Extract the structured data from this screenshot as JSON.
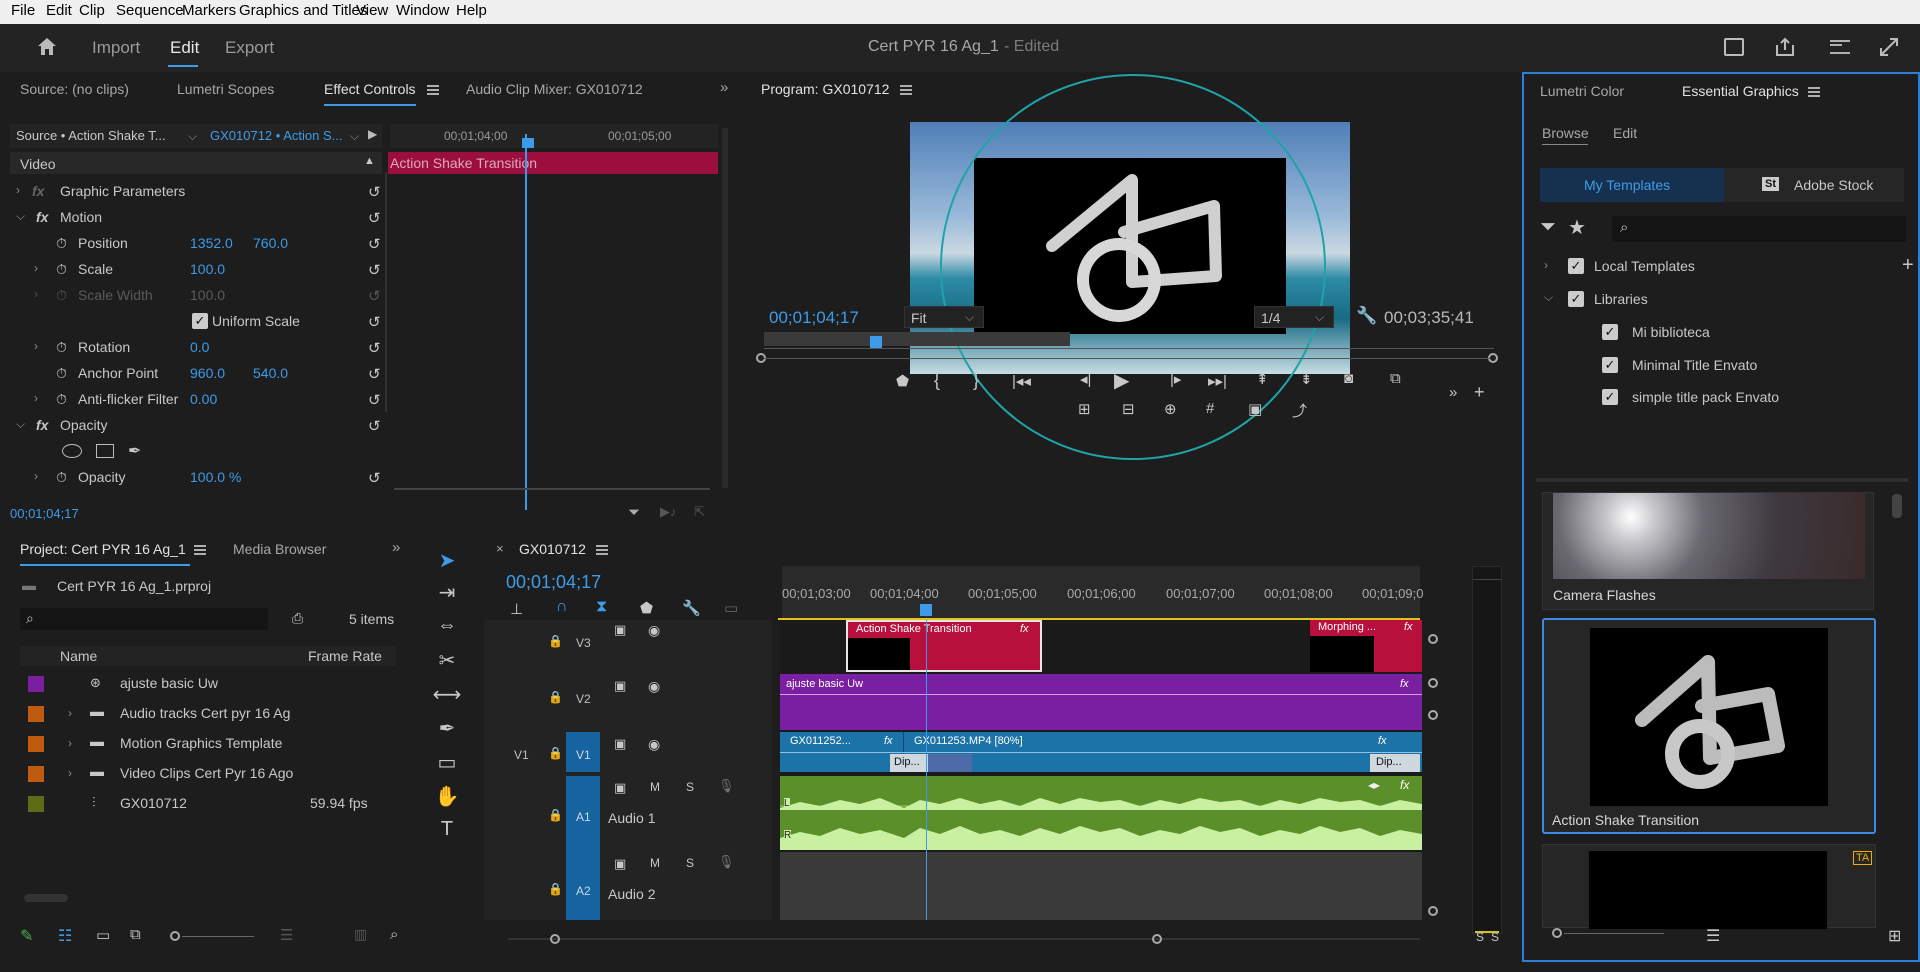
{
  "menu": [
    "File",
    "Edit",
    "Clip",
    "Sequence",
    "Markers",
    "Graphics and Titles",
    "View",
    "Window",
    "Help"
  ],
  "header": {
    "import": "Import",
    "edit": "Edit",
    "export": "Export",
    "project_title": "Cert PYR 16 Ag_1",
    "edited": "- Edited"
  },
  "source_panel": {
    "tabs": [
      "Source: (no clips)",
      "Lumetri Scopes",
      "Effect Controls",
      "Audio Clip Mixer: GX010712"
    ],
    "source_select": "Source • Action Shake T...",
    "sequence_select": "GX010712 • Action S...",
    "ruler_times": [
      "00;01;04;00",
      "00;01;05;00"
    ],
    "section_video": "Video",
    "clip_label": "Action Shake Transition",
    "rows": [
      {
        "name": "Graphic Parameters"
      },
      {
        "name": "Motion"
      },
      {
        "name": "Position",
        "v1": "1352.0",
        "v2": "760.0"
      },
      {
        "name": "Scale",
        "v1": "100.0"
      },
      {
        "name": "Scale Width",
        "v1": "100.0"
      },
      {
        "name": "Uniform Scale"
      },
      {
        "name": "Rotation",
        "v1": "0.0"
      },
      {
        "name": "Anchor Point",
        "v1": "960.0",
        "v2": "540.0"
      },
      {
        "name": "Anti-flicker Filter",
        "v1": "0.00"
      },
      {
        "name": "Opacity"
      },
      {
        "name": "Opacity",
        "v1": "100.0 %"
      }
    ],
    "timecode": "00;01;04;17"
  },
  "program": {
    "title": "Program: GX010712",
    "timecode": "00;01;04;17",
    "fit": "Fit",
    "resolution": "1/4",
    "duration": "00;03;35;41"
  },
  "essential": {
    "tabs": [
      "Lumetri Color",
      "Essential Graphics"
    ],
    "subtabs": [
      "Browse",
      "Edit"
    ],
    "my_templates": "My Templates",
    "adobe_stock": "Adobe Stock",
    "tree": [
      "Local Templates",
      "Libraries",
      "Mi biblioteca",
      "Minimal Title Envato",
      "simple title pack Envato"
    ],
    "templates": [
      "Camera Flashes",
      "Action Shake Transition"
    ]
  },
  "project": {
    "tabs": [
      "Project: Cert PYR 16 Ag_1",
      "Media Browser"
    ],
    "file": "Cert PYR 16 Ag_1.prproj",
    "count": "5 items",
    "col_name": "Name",
    "col_rate": "Frame Rate",
    "items": [
      {
        "name": "ajuste basic Uw",
        "rate": "",
        "color": "#7b1fa2"
      },
      {
        "name": "Audio tracks Cert pyr 16 Ag",
        "rate": "",
        "color": "#c05a10"
      },
      {
        "name": "Motion Graphics Template",
        "rate": "",
        "color": "#c05a10"
      },
      {
        "name": "Video Clips Cert Pyr 16 Ago",
        "rate": "",
        "color": "#c05a10"
      },
      {
        "name": "GX010712",
        "rate": "59.94 fps",
        "color": "#5c6b14"
      }
    ]
  },
  "timeline": {
    "tab": "GX010712",
    "timecode": "00;01;04;17",
    "ruler": [
      "00;01;03;00",
      "00;01;04;00",
      "00;01;05;00",
      "00;01;06;00",
      "00;01;07;00",
      "00;01;08;00",
      "00;01;09;0"
    ],
    "tracks": {
      "v3": "V3",
      "v2": "V2",
      "v1": "V1",
      "v1s": "V1",
      "a1": "A1",
      "a2": "A2",
      "a1name": "Audio 1",
      "a2name": "Audio 2",
      "m": "M",
      "s": "S"
    },
    "clips": {
      "v3a": "Action Shake Transition",
      "v3b": "Morphing ...",
      "v2": "ajuste basic Uw",
      "v1a": "GX011252...",
      "v1b": "GX011253.MP4 [80%]",
      "dip1": "Dip...",
      "dip2": "Dip..."
    },
    "meter": [
      "S",
      "S"
    ]
  }
}
